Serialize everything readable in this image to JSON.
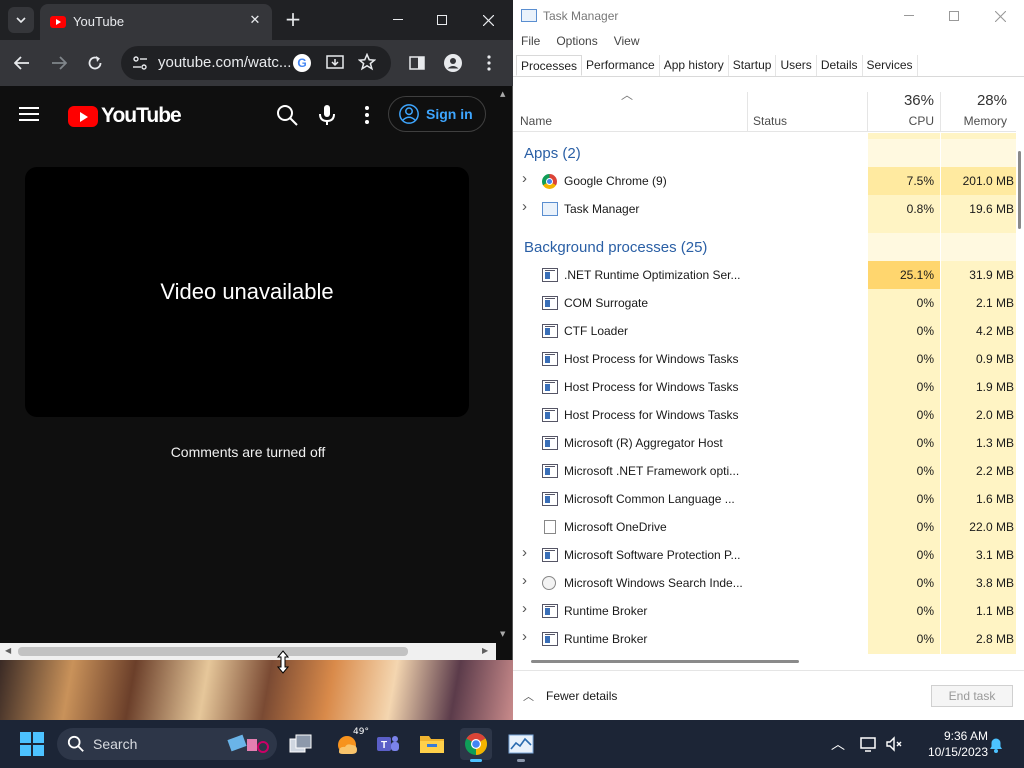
{
  "chrome": {
    "tab_title": "YouTube",
    "url": "youtube.com/watc...",
    "youtube": {
      "logo_text": "YouTube",
      "signin_label": "Sign in",
      "video_message": "Video unavailable",
      "comments_message": "Comments are turned off"
    }
  },
  "task_manager": {
    "title": "Task Manager",
    "menu": [
      "File",
      "Options",
      "View"
    ],
    "tabs": [
      "Processes",
      "Performance",
      "App history",
      "Startup",
      "Users",
      "Details",
      "Services"
    ],
    "active_tab": "Processes",
    "columns": {
      "name": "Name",
      "status": "Status",
      "cpu_total": "36%",
      "cpu_label": "CPU",
      "memory_total": "28%",
      "memory_label": "Memory"
    },
    "groups": [
      {
        "label": "Apps (2)",
        "processes": [
          {
            "name": "Google Chrome (9)",
            "cpu": "7.5%",
            "memory": "201.0 MB",
            "icon": "chrome-icon",
            "expandable": true
          },
          {
            "name": "Task Manager",
            "cpu": "0.8%",
            "memory": "19.6 MB",
            "icon": "task-manager-icon",
            "expandable": true
          }
        ]
      },
      {
        "label": "Background processes (25)",
        "processes": [
          {
            "name": ".NET Runtime Optimization Ser...",
            "cpu": "25.1%",
            "memory": "31.9 MB",
            "icon": "window-app-icon",
            "expandable": false
          },
          {
            "name": "COM Surrogate",
            "cpu": "0%",
            "memory": "2.1 MB",
            "icon": "window-app-icon",
            "expandable": false
          },
          {
            "name": "CTF Loader",
            "cpu": "0%",
            "memory": "4.2 MB",
            "icon": "window-app-icon",
            "expandable": false
          },
          {
            "name": "Host Process for Windows Tasks",
            "cpu": "0%",
            "memory": "0.9 MB",
            "icon": "window-app-icon",
            "expandable": false
          },
          {
            "name": "Host Process for Windows Tasks",
            "cpu": "0%",
            "memory": "1.9 MB",
            "icon": "window-app-icon",
            "expandable": false
          },
          {
            "name": "Host Process for Windows Tasks",
            "cpu": "0%",
            "memory": "2.0 MB",
            "icon": "window-app-icon",
            "expandable": false
          },
          {
            "name": "Microsoft (R) Aggregator Host",
            "cpu": "0%",
            "memory": "1.3 MB",
            "icon": "window-app-icon",
            "expandable": false
          },
          {
            "name": "Microsoft .NET Framework opti...",
            "cpu": "0%",
            "memory": "2.2 MB",
            "icon": "window-app-icon",
            "expandable": false
          },
          {
            "name": "Microsoft Common Language ...",
            "cpu": "0%",
            "memory": "1.6 MB",
            "icon": "window-app-icon",
            "expandable": false
          },
          {
            "name": "Microsoft OneDrive",
            "cpu": "0%",
            "memory": "22.0 MB",
            "icon": "file-icon",
            "expandable": false
          },
          {
            "name": "Microsoft Software Protection P...",
            "cpu": "0%",
            "memory": "3.1 MB",
            "icon": "window-app-icon",
            "expandable": true
          },
          {
            "name": "Microsoft Windows Search Inde...",
            "cpu": "0%",
            "memory": "3.8 MB",
            "icon": "search-indexer-icon",
            "expandable": true
          },
          {
            "name": "Runtime Broker",
            "cpu": "0%",
            "memory": "1.1 MB",
            "icon": "window-app-icon",
            "expandable": true
          },
          {
            "name": "Runtime Broker",
            "cpu": "0%",
            "memory": "2.8 MB",
            "icon": "window-app-icon",
            "expandable": true
          }
        ]
      }
    ],
    "fewer_details_label": "Fewer details",
    "end_task_label": "End task"
  },
  "taskbar": {
    "search_placeholder": "Search",
    "weather_temp": "49°",
    "clock_time": "9:36 AM",
    "clock_date": "10/15/2023"
  }
}
